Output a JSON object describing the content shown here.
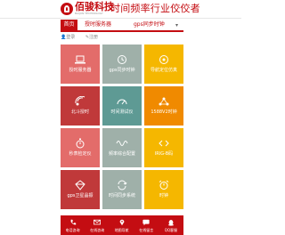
{
  "header": {
    "brand": "佰骏科技",
    "brand_sub": "BAIJUN TECHNOLOGY",
    "slogan": "时间频率行业佼佼者",
    "accent_color": "#c40d12"
  },
  "nav": {
    "items": [
      "首页",
      "授时服务器",
      "gps同步时钟"
    ],
    "more_icon": "chevron-down-icon"
  },
  "account": {
    "login": "登录",
    "register": "注册"
  },
  "tiles": [
    {
      "label": "授时服务器",
      "color": "#e36c6a",
      "icon": "laptop-icon"
    },
    {
      "label": "gps同步时钟",
      "color": "#9fb0a9",
      "icon": "clock-icon"
    },
    {
      "label": "导航定位仿真",
      "color": "#f5b700",
      "icon": "target-icon"
    },
    {
      "label": "北斗授时",
      "color": "#c0393a",
      "icon": "satellite-icon"
    },
    {
      "label": "时间测试仪",
      "color": "#5e9a94",
      "icon": "meter-icon"
    },
    {
      "label": "1588V2时钟",
      "color": "#f08a00",
      "icon": "network-icon"
    },
    {
      "label": "秒表检定仪",
      "color": "#e36c6a",
      "icon": "stopwatch-icon"
    },
    {
      "label": "频率综合配置",
      "color": "#9fb0a9",
      "icon": "wave-icon"
    },
    {
      "label": "IRIG-B码",
      "color": "#f5b700",
      "icon": "code-icon"
    },
    {
      "label": "gps卫星晶振",
      "color": "#c0393a",
      "icon": "crystal-icon"
    },
    {
      "label": "时间同步系统",
      "color": "#9fb0a9",
      "icon": "sync-icon"
    },
    {
      "label": "时钟",
      "color": "#f5b700",
      "icon": "alarm-icon"
    }
  ],
  "bottom_bar": [
    {
      "label": "电话咨询",
      "icon": "phone-icon"
    },
    {
      "label": "在线咨询",
      "icon": "mail-icon"
    },
    {
      "label": "地图导航",
      "icon": "map-pin-icon"
    },
    {
      "label": "在线留言",
      "icon": "message-icon"
    },
    {
      "label": "QQ客服",
      "icon": "qq-icon"
    }
  ]
}
